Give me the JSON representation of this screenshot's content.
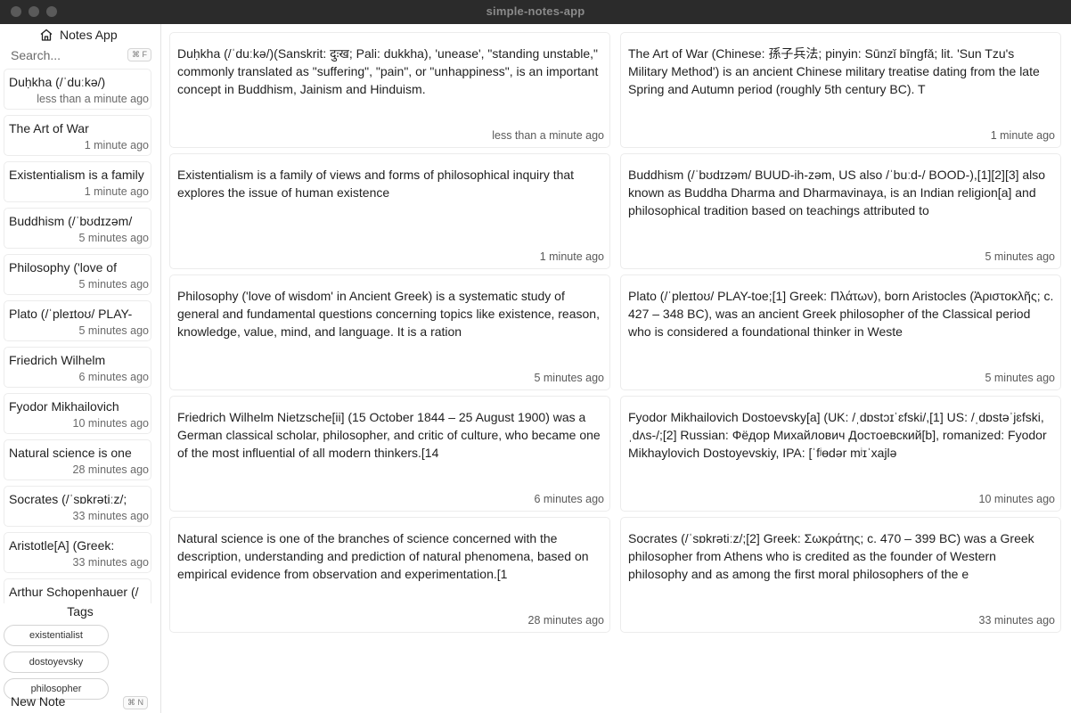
{
  "window": {
    "title": "simple-notes-app"
  },
  "sidebar": {
    "app_title": "Notes App",
    "search": {
      "placeholder": "Search...",
      "shortcut": "⌘ F"
    },
    "notes": [
      {
        "title": "Duḥkha (/ˈduːkə/)",
        "time": "less than a minute ago"
      },
      {
        "title": "The Art of War",
        "time": "1 minute ago"
      },
      {
        "title": "Existentialism is a family",
        "time": "1 minute ago"
      },
      {
        "title": "Buddhism (/ˈbʊdɪzəm/",
        "time": "5 minutes ago"
      },
      {
        "title": "Philosophy ('love of",
        "time": "5 minutes ago"
      },
      {
        "title": "Plato (/ˈpleɪtoʊ/ PLAY-",
        "time": "5 minutes ago"
      },
      {
        "title": "Friedrich Wilhelm",
        "time": "6 minutes ago"
      },
      {
        "title": "Fyodor Mikhailovich",
        "time": "10 minutes ago"
      },
      {
        "title": "Natural science is one",
        "time": "28 minutes ago"
      },
      {
        "title": "Socrates (/ˈsɒkrətiːz/;",
        "time": "33 minutes ago"
      },
      {
        "title": "Aristotle[A] (Greek:",
        "time": "33 minutes ago"
      },
      {
        "title": "Arthur Schopenhauer (/",
        "time": ""
      }
    ],
    "tags_heading": "Tags",
    "tags": [
      "existentialist",
      "dostoyevsky",
      "philosopher"
    ],
    "new_note": {
      "label": "New Note",
      "shortcut": "⌘ N"
    }
  },
  "main": {
    "cards": [
      {
        "body": "Duḥkha (/ˈduːkə/)(Sanskrit: दुःख; Pali: dukkha), 'unease', \"standing unstable,\" commonly translated as \"suffering\", \"pain\", or \"unhappiness\", is an important concept in Buddhism, Jainism and Hinduism.",
        "time": "less than a minute ago"
      },
      {
        "body": "The Art of War (Chinese: 孫子兵法; pinyin: Sūnzǐ bīngfǎ; lit. 'Sun Tzu's Military Method') is an ancient Chinese military treatise dating from the late Spring and Autumn period (roughly 5th century BC). T",
        "time": "1 minute ago"
      },
      {
        "body": "Existentialism is a family of views and forms of philosophical inquiry that explores the issue of human existence",
        "time": "1 minute ago"
      },
      {
        "body": "Buddhism (/ˈbʊdɪzəm/ BUUD-ih-zəm, US also /ˈbuːd-/ BOOD-),[1][2][3] also known as Buddha Dharma and Dharmavinaya, is an Indian religion[a] and philosophical tradition based on teachings attributed to",
        "time": "5 minutes ago"
      },
      {
        "body": "Philosophy ('love of wisdom' in Ancient Greek) is a systematic study of general and fundamental questions concerning topics like existence, reason, knowledge, value, mind, and language. It is a ration",
        "time": "5 minutes ago"
      },
      {
        "body": "Plato (/ˈpleɪtoʊ/ PLAY-toe;[1] Greek: Πλάτων), born Aristocles (Ἀριστοκλῆς; c. 427 – 348 BC), was an ancient Greek philosopher of the Classical period who is considered a foundational thinker in Weste",
        "time": "5 minutes ago"
      },
      {
        "body": "Friedrich Wilhelm Nietzsche[ii] (15 October 1844 – 25 August 1900) was a German classical scholar, philosopher, and critic of culture, who became one of the most influential of all modern thinkers.[14",
        "time": "6 minutes ago"
      },
      {
        "body": "Fyodor Mikhailovich Dostoevsky[a] (UK: /ˌdɒstɔɪˈɛfski/,[1] US: /ˌdɒstəˈjɛfski, ˌdʌs-/;[2] Russian: Фёдор Михайлович Достоевский[b], romanized: Fyodor Mikhaylovich Dostoyevskiy, IPA: [ˈfʲɵdər mʲɪˈxajlə",
        "time": "10 minutes ago"
      },
      {
        "body": "Natural science is one of the branches of science concerned with the description, understanding and prediction of natural phenomena, based on empirical evidence from observation and experimentation.[1",
        "time": "28 minutes ago"
      },
      {
        "body": "Socrates (/ˈsɒkrətiːz/;[2] Greek: Σωκράτης; c. 470 – 399 BC) was a Greek philosopher from Athens who is credited as the founder of Western philosophy and as among the first moral philosophers of the e",
        "time": "33 minutes ago"
      }
    ]
  }
}
